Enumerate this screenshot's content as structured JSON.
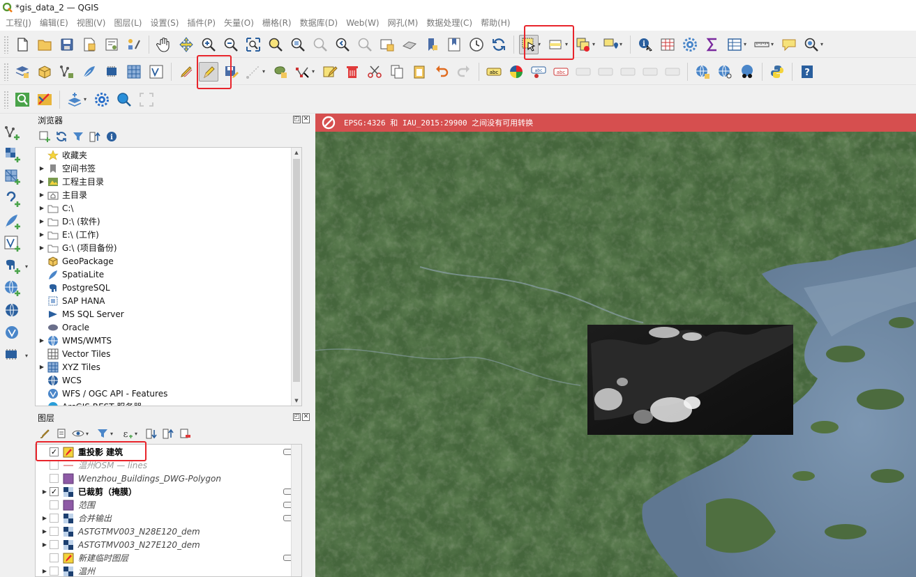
{
  "window": {
    "title": "*gis_data_2 — QGIS"
  },
  "menu": [
    "工程(J)",
    "编辑(E)",
    "视图(V)",
    "图层(L)",
    "设置(S)",
    "插件(P)",
    "矢量(O)",
    "栅格(R)",
    "数据库(D)",
    "Web(W)",
    "网孔(M)",
    "数据处理(C)",
    "帮助(H)"
  ],
  "browser": {
    "title": "浏览器",
    "items": [
      {
        "label": "收藏夹",
        "icon": "star-icon",
        "expand": false
      },
      {
        "label": "空间书签",
        "icon": "bookmark-icon",
        "expand": true
      },
      {
        "label": "工程主目录",
        "icon": "project-home-icon",
        "expand": true
      },
      {
        "label": "主目录",
        "icon": "home-folder-icon",
        "expand": true
      },
      {
        "label": "C:\\",
        "icon": "folder-icon",
        "expand": true
      },
      {
        "label": "D:\\ (软件)",
        "icon": "folder-icon",
        "expand": true
      },
      {
        "label": "E:\\ (工作)",
        "icon": "folder-icon",
        "expand": true
      },
      {
        "label": "G:\\ (项目备份)",
        "icon": "folder-icon",
        "expand": true
      },
      {
        "label": "GeoPackage",
        "icon": "geopackage-icon",
        "expand": false
      },
      {
        "label": "SpatiaLite",
        "icon": "spatialite-icon",
        "expand": false
      },
      {
        "label": "PostgreSQL",
        "icon": "postgresql-icon",
        "expand": false
      },
      {
        "label": "SAP HANA",
        "icon": "sap-hana-icon",
        "expand": false
      },
      {
        "label": "MS SQL Server",
        "icon": "mssql-icon",
        "expand": false
      },
      {
        "label": "Oracle",
        "icon": "oracle-icon",
        "expand": false
      },
      {
        "label": "WMS/WMTS",
        "icon": "wms-icon",
        "expand": true
      },
      {
        "label": "Vector Tiles",
        "icon": "vector-tiles-icon",
        "expand": false
      },
      {
        "label": "XYZ Tiles",
        "icon": "xyz-tiles-icon",
        "expand": true
      },
      {
        "label": "WCS",
        "icon": "wcs-icon",
        "expand": false
      },
      {
        "label": "WFS / OGC API - Features",
        "icon": "wfs-icon",
        "expand": false
      },
      {
        "label": "ArcGIS REST 服务器",
        "icon": "arcgis-icon",
        "expand": false
      }
    ]
  },
  "layers": {
    "title": "图层",
    "items": [
      {
        "name": "重投影 建筑",
        "checked": true,
        "expand": false,
        "icon": "edit-layer-icon",
        "style": "bold",
        "indicator": true
      },
      {
        "name": "温州OSM — lines",
        "checked": false,
        "expand": false,
        "icon": "line-layer-icon",
        "style": "strike",
        "indicator": false
      },
      {
        "name": "Wenzhou_Buildings_DWG-Polygon",
        "checked": false,
        "expand": false,
        "icon": "polygon-layer-icon",
        "style": "italic",
        "indicator": false
      },
      {
        "name": "已裁剪（掩膜）",
        "checked": true,
        "expand": true,
        "icon": "raster-layer-icon",
        "style": "bold",
        "indicator": true
      },
      {
        "name": "范围",
        "checked": false,
        "expand": false,
        "icon": "polygon-layer-icon",
        "style": "italic",
        "indicator": true
      },
      {
        "name": "合并输出",
        "checked": false,
        "expand": true,
        "icon": "raster-layer-icon",
        "style": "italic",
        "indicator": true
      },
      {
        "name": "ASTGTMV003_N28E120_dem",
        "checked": false,
        "expand": true,
        "icon": "raster-layer-icon",
        "style": "italic",
        "indicator": false
      },
      {
        "name": "ASTGTMV003_N27E120_dem",
        "checked": false,
        "expand": true,
        "icon": "raster-layer-icon",
        "style": "italic",
        "indicator": false
      },
      {
        "name": "新建临时图层",
        "checked": false,
        "expand": false,
        "icon": "edit-layer-icon",
        "style": "italic",
        "indicator": true
      },
      {
        "name": "温州",
        "checked": false,
        "expand": true,
        "icon": "raster-layer-icon",
        "style": "italic",
        "indicator": false
      }
    ]
  },
  "map": {
    "message": "EPSG:4326 和 IAU_2015:29900 之间没有可用转换"
  },
  "colors": {
    "highlight": "#e8242b",
    "message_bar": "#d64f4f",
    "water": "#6d87a0",
    "forest": "#3d5c34"
  }
}
